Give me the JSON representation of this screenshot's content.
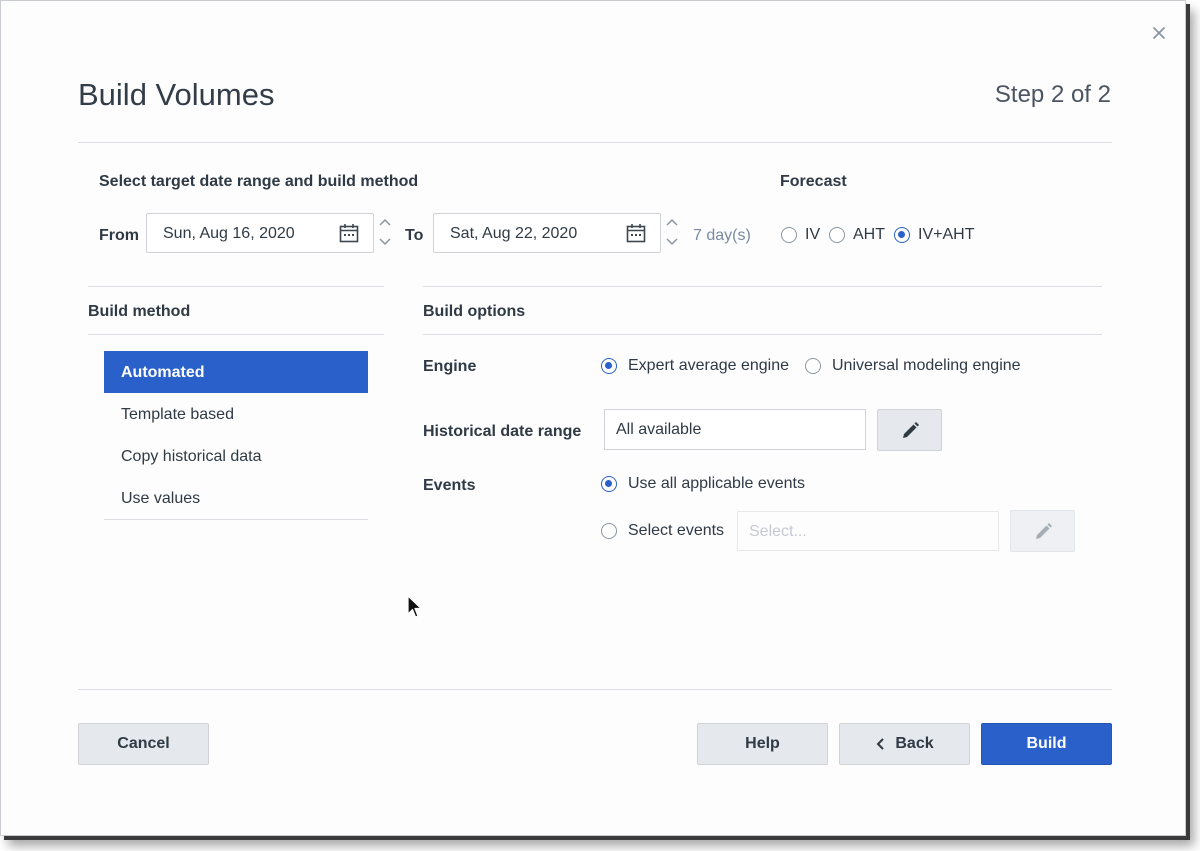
{
  "dialog": {
    "title": "Build Volumes",
    "step": "Step 2 of 2"
  },
  "date_range": {
    "section_label": "Select target date range and build method",
    "from_label": "From",
    "from_value": "Sun, Aug 16, 2020",
    "to_label": "To",
    "to_value": "Sat, Aug 22, 2020",
    "duration": "7 day(s)"
  },
  "forecast": {
    "label": "Forecast",
    "options": [
      {
        "label": "IV",
        "selected": false
      },
      {
        "label": "AHT",
        "selected": false
      },
      {
        "label": "IV+AHT",
        "selected": true
      }
    ]
  },
  "build_method": {
    "header": "Build method",
    "items": [
      {
        "label": "Automated",
        "selected": true
      },
      {
        "label": "Template based",
        "selected": false
      },
      {
        "label": "Copy historical data",
        "selected": false
      },
      {
        "label": "Use values",
        "selected": false
      }
    ]
  },
  "build_options": {
    "header": "Build options",
    "engine": {
      "label": "Engine",
      "options": [
        {
          "label": "Expert average engine",
          "selected": true
        },
        {
          "label": "Universal modeling engine",
          "selected": false
        }
      ]
    },
    "historical": {
      "label": "Historical date range",
      "value": "All available"
    },
    "events": {
      "label": "Events",
      "option_all": "Use all applicable events",
      "option_select": "Select events",
      "select_placeholder": "Select..."
    }
  },
  "footer": {
    "cancel": "Cancel",
    "help": "Help",
    "back": "Back",
    "build": "Build"
  },
  "colors": {
    "accent": "#2a60c9",
    "secondary_button": "#e5e8ed"
  },
  "icons": [
    "close-icon",
    "calendar-icon",
    "chevron-up-icon",
    "chevron-down-icon",
    "pencil-icon",
    "chevron-left-icon",
    "mouse-cursor-icon"
  ]
}
